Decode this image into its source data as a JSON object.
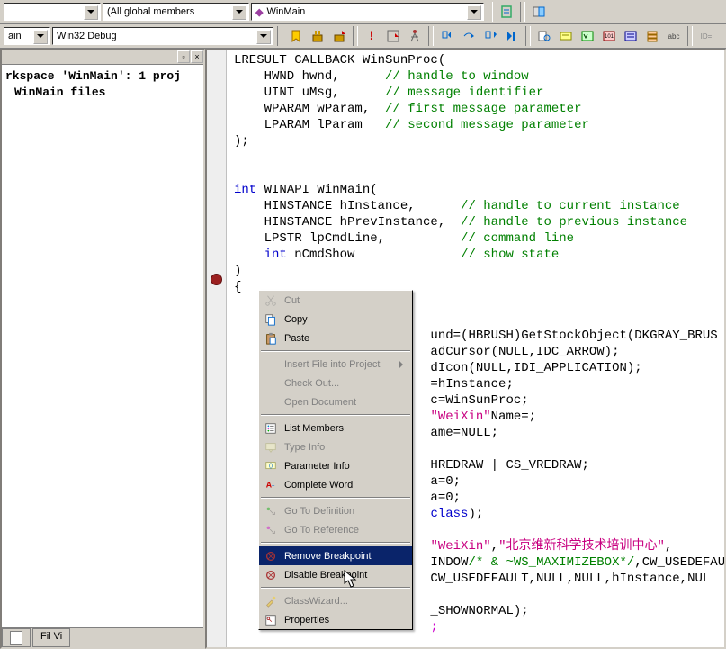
{
  "toolbar1": {
    "combo1": "",
    "combo2": "(All global members",
    "combo3": "WinMain"
  },
  "toolbar2": {
    "combo1": "ain",
    "combo2": "Win32 Debug"
  },
  "workspace": {
    "line1": "rkspace 'WinMain': 1 proj",
    "line2": "WinMain files"
  },
  "code": {
    "lines": [
      {
        "raw": "LRESULT CALLBACK WinSunProc("
      },
      {
        "indent": "    ",
        "text": "HWND hwnd,",
        "pad": "      ",
        "comment": "// handle to window"
      },
      {
        "indent": "    ",
        "text": "UINT uMsg,",
        "pad": "      ",
        "comment": "// message identifier"
      },
      {
        "indent": "    ",
        "text": "WPARAM wParam,",
        "pad": "  ",
        "comment": "// first message parameter"
      },
      {
        "indent": "    ",
        "text": "LPARAM lParam",
        "pad": "   ",
        "comment": "// second message parameter"
      },
      {
        "raw": ");"
      },
      {
        "raw": ""
      },
      {
        "raw": ""
      },
      {
        "kw": "int",
        "text": " WINAPI WinMain("
      },
      {
        "indent": "    ",
        "text": "HINSTANCE hInstance,",
        "pad": "      ",
        "comment": "// handle to current instance"
      },
      {
        "indent": "    ",
        "text": "HINSTANCE hPrevInstance,",
        "pad": "  ",
        "comment": "// handle to previous instance"
      },
      {
        "indent": "    ",
        "text": "LPSTR lpCmdLine,",
        "pad": "          ",
        "comment": "// command line"
      },
      {
        "indent": "    ",
        "kw": "int",
        "text": " nCmdShow",
        "pad": "              ",
        "comment": "// show state"
      },
      {
        "raw": ")"
      },
      {
        "raw": "{"
      },
      {
        "raw": ""
      },
      {
        "raw": ""
      },
      {
        "indent": "                          ",
        "text": "und=(HBRUSH)GetStockObject(DKGRAY_BRUS"
      },
      {
        "indent": "                          ",
        "text": "adCursor(NULL,IDC_ARROW);"
      },
      {
        "indent": "                          ",
        "text": "dIcon(NULL,IDI_APPLICATION);"
      },
      {
        "indent": "                          ",
        "text": "=hInstance;"
      },
      {
        "indent": "                          ",
        "text": "c=WinSunProc;"
      },
      {
        "indent": "                          ",
        "text": "Name=",
        "str": "\"WeiXin\"",
        "tail": ";"
      },
      {
        "indent": "                          ",
        "text": "ame=NULL;"
      },
      {
        "raw": ""
      },
      {
        "indent": "                          ",
        "text": "HREDRAW | CS_VREDRAW;"
      },
      {
        "indent": "                          ",
        "text": "a=0;"
      },
      {
        "indent": "                          ",
        "text": "a=0;"
      },
      {
        "indent": "                          ",
        "kw": "class",
        "tail": ");"
      },
      {
        "raw": ""
      },
      {
        "indent": "                          ",
        "str": "\"WeiXin\"",
        "text2": ",",
        "str2": "\"北京维新科学技术培训中心\"",
        "tail": ","
      },
      {
        "indent": "                          ",
        "text": "INDOW",
        "cmi": "/* & ~WS_MAXIMIZEBOX*/",
        "tail": ",CW_USEDEFAU"
      },
      {
        "indent": "                          ",
        "text": "CW_USEDEFAULT,NULL,NULL,hInstance,NUL"
      },
      {
        "raw": ""
      },
      {
        "indent": "                          ",
        "text": "_SHOWNORMAL);"
      },
      {
        "indent": "                          ",
        "tail_colored": ";"
      }
    ]
  },
  "context_menu": {
    "items": [
      {
        "label": "Cut",
        "disabled": true,
        "icon": "cut-icon"
      },
      {
        "label": "Copy",
        "disabled": false,
        "icon": "copy-icon"
      },
      {
        "label": "Paste",
        "disabled": false,
        "icon": "paste-icon"
      },
      {
        "sep": true
      },
      {
        "label": "Insert File into Project",
        "disabled": true,
        "arrow": true
      },
      {
        "label": "Check Out...",
        "disabled": true
      },
      {
        "label": "Open Document",
        "disabled": true
      },
      {
        "sep": true
      },
      {
        "label": "List Members",
        "disabled": false,
        "icon": "list-members-icon"
      },
      {
        "label": "Type Info",
        "disabled": true,
        "icon": "type-info-icon"
      },
      {
        "label": "Parameter Info",
        "disabled": false,
        "icon": "parameter-info-icon"
      },
      {
        "label": "Complete Word",
        "disabled": false,
        "icon": "complete-word-icon"
      },
      {
        "sep": true
      },
      {
        "label": "Go To Definition",
        "disabled": true,
        "icon": "goto-def-icon"
      },
      {
        "label": "Go To Reference",
        "disabled": true,
        "icon": "goto-ref-icon"
      },
      {
        "sep": true
      },
      {
        "label": "Remove Breakpoint",
        "disabled": false,
        "highlighted": true,
        "icon": "breakpoint-icon"
      },
      {
        "label": "Disable Breakpoint",
        "disabled": false,
        "icon": "breakpoint-icon"
      },
      {
        "sep": true
      },
      {
        "label": "ClassWizard...",
        "disabled": true,
        "icon": "wizard-icon"
      },
      {
        "label": "Properties",
        "disabled": false,
        "icon": "properties-icon"
      }
    ]
  },
  "tabs": {
    "tab2": "Fil  Vi"
  }
}
